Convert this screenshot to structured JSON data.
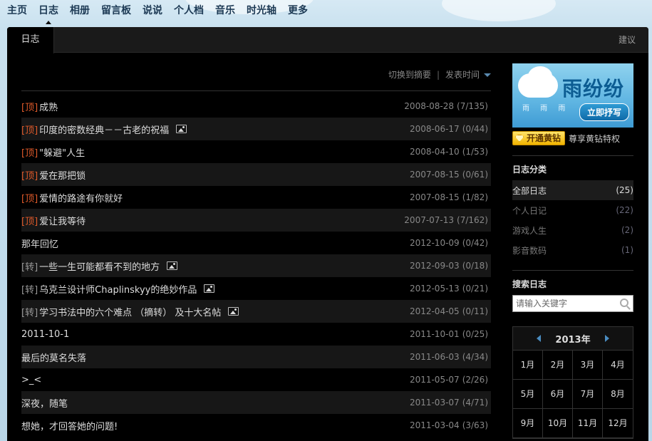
{
  "nav": {
    "items": [
      "主页",
      "日志",
      "相册",
      "留言板",
      "说说",
      "个人档",
      "音乐",
      "时光轴",
      "更多"
    ],
    "active": "日志"
  },
  "panel": {
    "tab_label": "日志",
    "suggest_label": "建议"
  },
  "tools": {
    "switch_label": "切换到摘要",
    "separator": "|",
    "sort_label": "发表时间"
  },
  "posts": [
    {
      "tag": "[顶]",
      "tag_type": "top",
      "title": "成熟",
      "has_image": false,
      "date": "2008-08-28",
      "counts": "(7/135)"
    },
    {
      "tag": "[顶]",
      "tag_type": "top",
      "title": "印度的密数经典－－古老的祝福",
      "has_image": true,
      "date": "2008-06-17",
      "counts": "(0/44)"
    },
    {
      "tag": "[顶]",
      "tag_type": "top",
      "title": "\"躲避\"人生",
      "has_image": false,
      "date": "2008-04-10",
      "counts": "(1/53)"
    },
    {
      "tag": "[顶]",
      "tag_type": "top",
      "title": "爱在那把锁",
      "has_image": false,
      "date": "2007-08-15",
      "counts": "(0/61)"
    },
    {
      "tag": "[顶]",
      "tag_type": "top",
      "title": "爱情的路途有你就好",
      "has_image": false,
      "date": "2007-08-15",
      "counts": "(1/82)"
    },
    {
      "tag": "[顶]",
      "tag_type": "top",
      "title": "爱让我等待",
      "has_image": false,
      "date": "2007-07-13",
      "counts": "(7/162)"
    },
    {
      "tag": "",
      "tag_type": "none",
      "title": "那年回忆",
      "has_image": false,
      "date": "2012-10-09",
      "counts": "(0/42)"
    },
    {
      "tag": "[转]",
      "tag_type": "fwd",
      "title": "一些一生可能都看不到的地方",
      "has_image": true,
      "date": "2012-09-03",
      "counts": "(0/18)"
    },
    {
      "tag": "[转]",
      "tag_type": "fwd",
      "title": "乌克兰设计师Chaplinskyy的绝妙作品",
      "has_image": true,
      "date": "2012-05-13",
      "counts": "(0/21)"
    },
    {
      "tag": "[转]",
      "tag_type": "fwd",
      "title": "学习书法中的六个难点 （摘转） 及十大名帖",
      "has_image": true,
      "date": "2012-04-05",
      "counts": "(0/11)"
    },
    {
      "tag": "",
      "tag_type": "none",
      "title": "2011-10-1",
      "has_image": false,
      "date": "2011-10-01",
      "counts": "(0/25)"
    },
    {
      "tag": "",
      "tag_type": "none",
      "title": "最后的莫名失落",
      "has_image": false,
      "date": "2011-06-03",
      "counts": "(4/34)"
    },
    {
      "tag": "",
      "tag_type": "none",
      "title": ">_<",
      "has_image": false,
      "date": "2011-05-07",
      "counts": "(2/26)"
    },
    {
      "tag": "",
      "tag_type": "none",
      "title": "深夜，随笔",
      "has_image": false,
      "date": "2011-03-07",
      "counts": "(4/71)"
    },
    {
      "tag": "",
      "tag_type": "none",
      "title": "想她，才回答她的问题!",
      "has_image": false,
      "date": "2011-03-04",
      "counts": "(3/63)"
    }
  ],
  "sidebar": {
    "banner": {
      "title": "雨纷纷",
      "cta": "立即抒写",
      "drops": "雨 雨 雨"
    },
    "vip_button": "开通黄钻",
    "vip_text": "尊享黄钻特权",
    "categories_title": "日志分类",
    "categories": [
      {
        "label": "全部日志",
        "count": "(25)",
        "active": true
      },
      {
        "label": "个人日记",
        "count": "(22)",
        "active": false
      },
      {
        "label": "游戏人生",
        "count": "(2)",
        "active": false
      },
      {
        "label": "影音数码",
        "count": "(1)",
        "active": false
      }
    ],
    "search_title": "搜索日志",
    "search_placeholder": "请输入关键字",
    "calendar": {
      "year": "2013年",
      "months": [
        "1月",
        "2月",
        "3月",
        "4月",
        "5月",
        "6月",
        "7月",
        "8月",
        "9月",
        "10月",
        "11月",
        "12月"
      ]
    }
  },
  "colors": {
    "top_tag": "#e05a2a",
    "accent": "#4a8cc0"
  }
}
